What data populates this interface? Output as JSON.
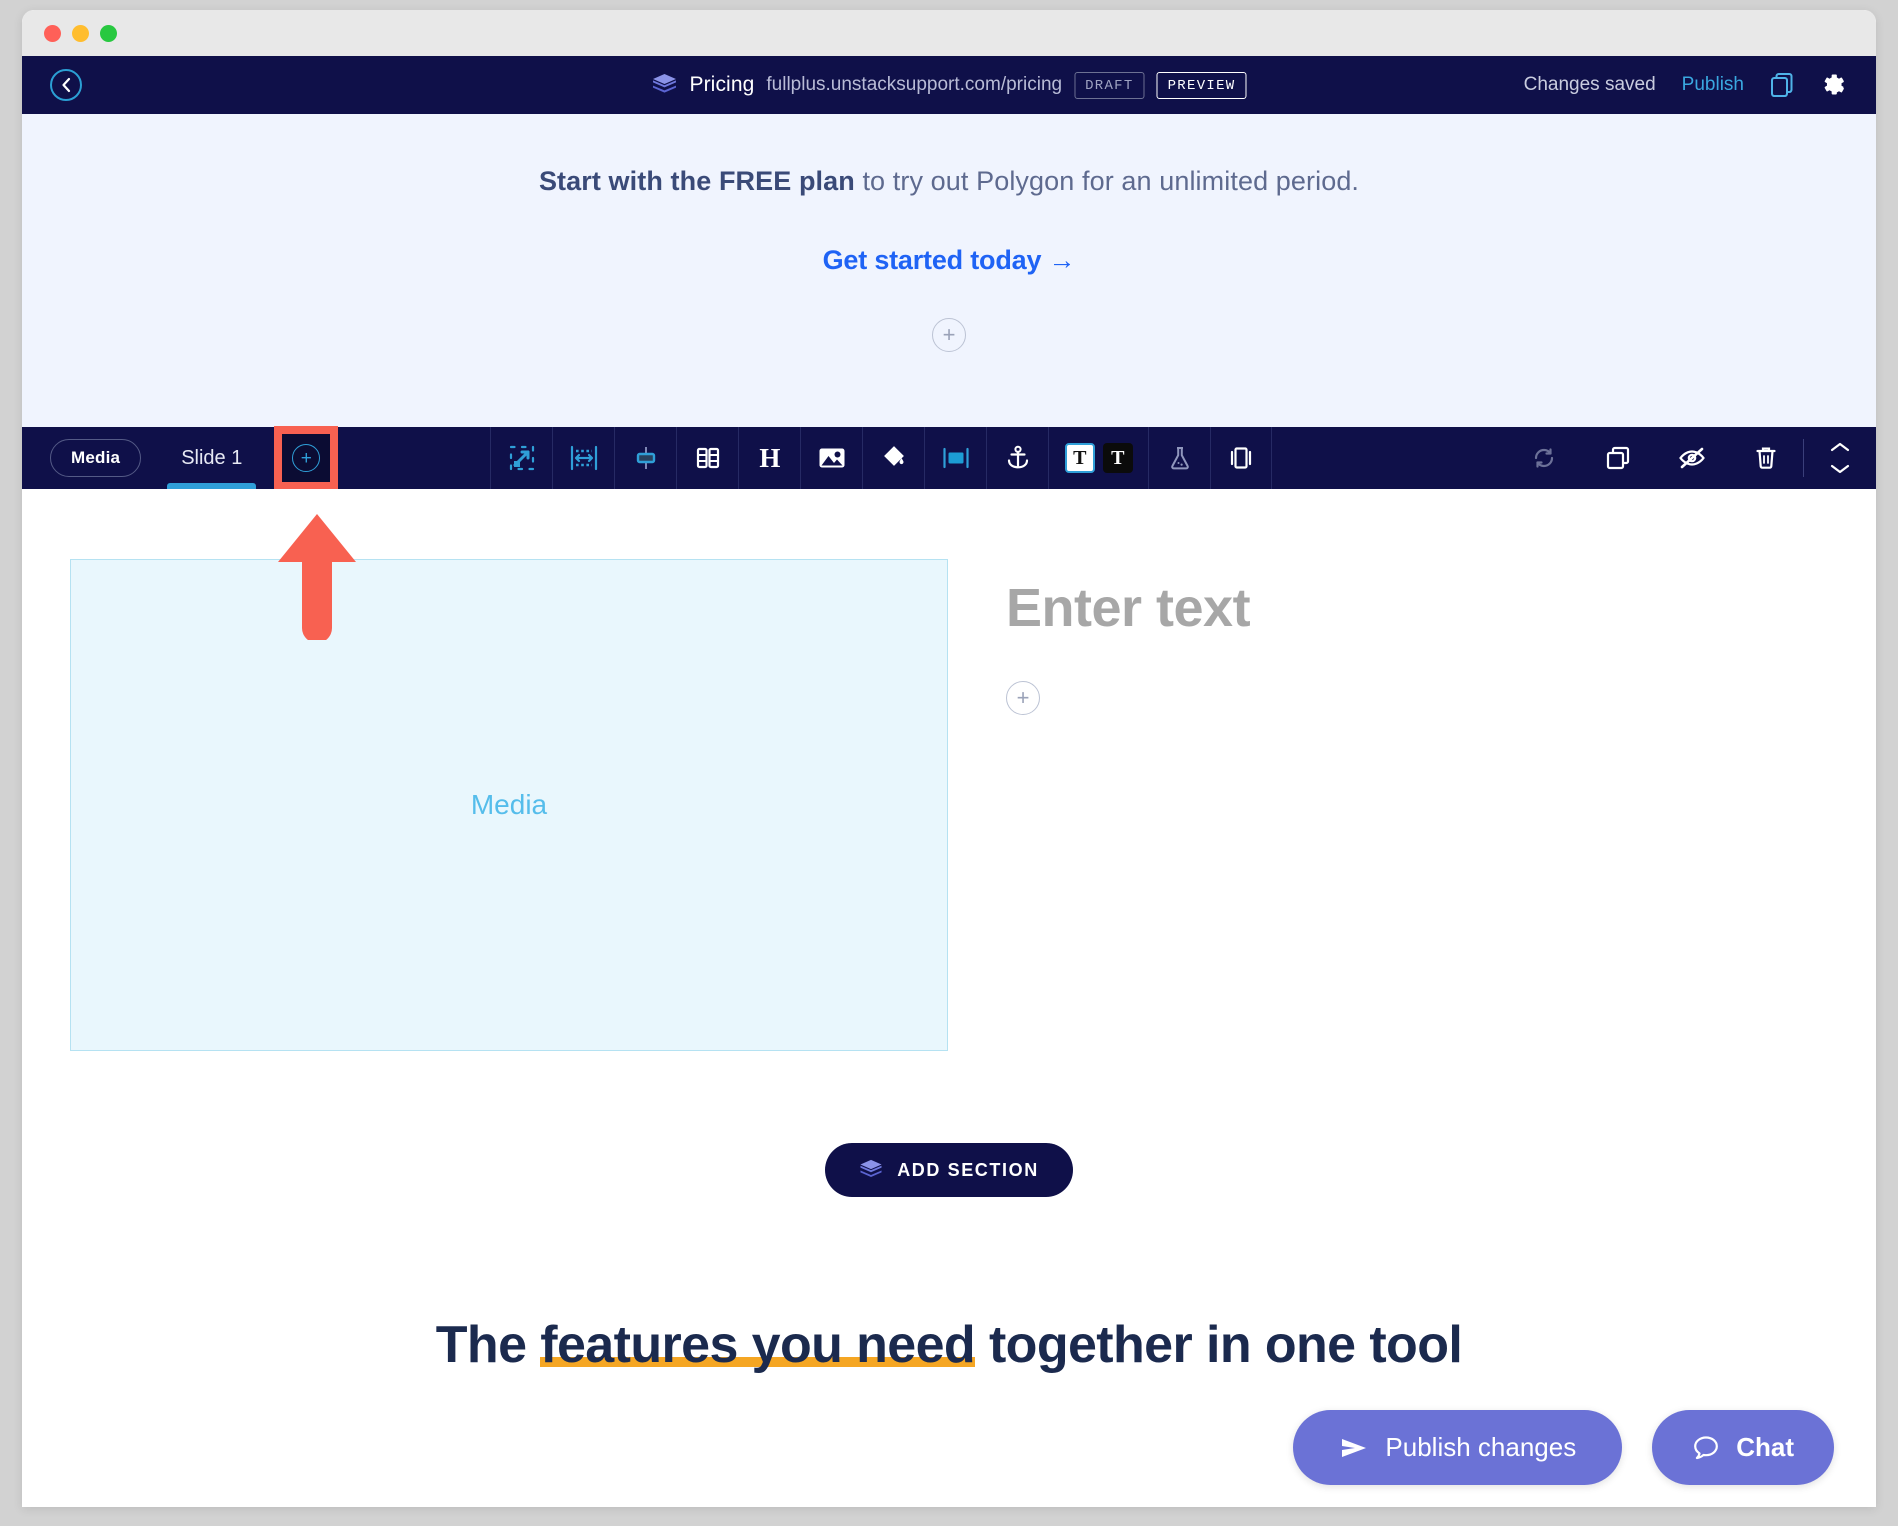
{
  "window": {
    "traffic_lights": [
      "close",
      "minimize",
      "maximize"
    ]
  },
  "appbar": {
    "back_icon": "chevron-left-icon",
    "brand_icon": "layers-icon",
    "doc_title": "Pricing",
    "doc_url": "fullplus.unstacksupport.com/pricing",
    "draft_badge": "DRAFT",
    "preview_badge": "PREVIEW",
    "status": "Changes saved",
    "publish_link": "Publish",
    "copy_icon": "duplicate-icon",
    "settings_icon": "gear-icon",
    "bg_color": "#0f1049",
    "accent_color": "#3aa8e0"
  },
  "banner": {
    "bold_text": "Start with the FREE plan",
    "rest_text": " to try out Polygon for an unlimited period.",
    "cta": "Get started today →",
    "add_block_icon": "plus-circle-icon",
    "bg_color": "#f0f4fe",
    "link_color": "#1f63f5"
  },
  "toolbar": {
    "media_pill": "Media",
    "slide_tab": "Slide 1",
    "add_slide_icon": "plus-circle-icon",
    "highlight_color": "#f86151",
    "tools": [
      {
        "name": "resize-icon",
        "label": "Resize"
      },
      {
        "name": "width-spacing-icon",
        "label": "Width"
      },
      {
        "name": "vertical-align-icon",
        "label": "Align"
      },
      {
        "name": "columns-icon",
        "label": "Columns"
      },
      {
        "name": "heading-icon",
        "label": "H"
      },
      {
        "name": "image-icon",
        "label": "Image"
      },
      {
        "name": "paint-bucket-icon",
        "label": "Fill"
      },
      {
        "name": "button-block-icon",
        "label": "Button"
      },
      {
        "name": "anchor-icon",
        "label": "Anchor"
      },
      {
        "name": "text-light-dark-toggle",
        "label": "T"
      },
      {
        "name": "flask-icon",
        "label": "Experiment"
      },
      {
        "name": "carousel-icon",
        "label": "Carousel"
      }
    ],
    "right_tools": [
      {
        "name": "sync-icon",
        "label": "Sync"
      },
      {
        "name": "duplicate-icon",
        "label": "Duplicate"
      },
      {
        "name": "eye-off-icon",
        "label": "Hide"
      },
      {
        "name": "trash-icon",
        "label": "Delete"
      }
    ],
    "move_up_icon": "chevron-up-icon",
    "move_down_icon": "chevron-down-icon",
    "text_light_label": "T",
    "text_dark_label": "T"
  },
  "canvas": {
    "media_placeholder": "Media",
    "text_placeholder": "Enter text",
    "add_block_icon": "plus-circle-icon",
    "add_section_label": "ADD SECTION",
    "add_section_icon": "layers-icon",
    "headline_pre": "The ",
    "headline_highlight": "features you need",
    "headline_post": " together in one tool",
    "media_border_color": "#b5e2f2",
    "media_bg_color": "#e9f7fd",
    "highlight_underline_color": "#f5a623"
  },
  "floating": {
    "publish_label": "Publish changes",
    "publish_icon": "send-icon",
    "chat_label": "Chat",
    "chat_icon": "chat-bubble-icon",
    "button_color": "#6b72d6"
  },
  "annotation": {
    "arrow_color": "#f86151",
    "points_to": "add-slide-button"
  }
}
